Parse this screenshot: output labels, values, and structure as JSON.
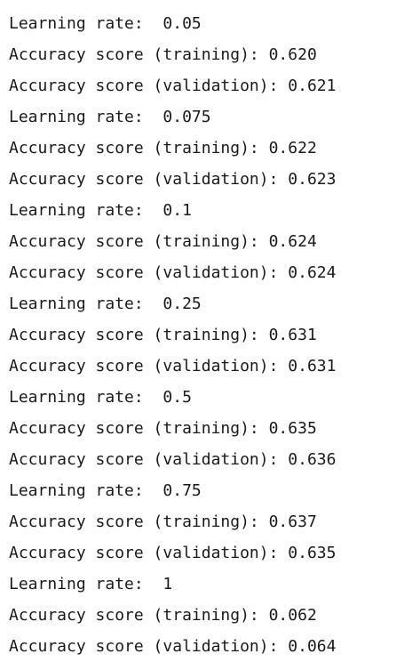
{
  "output": {
    "lines": [
      "Learning rate:  0.05",
      "Accuracy score (training): 0.620",
      "Accuracy score (validation): 0.621",
      "Learning rate:  0.075",
      "Accuracy score (training): 0.622",
      "Accuracy score (validation): 0.623",
      "Learning rate:  0.1",
      "Accuracy score (training): 0.624",
      "Accuracy score (validation): 0.624",
      "Learning rate:  0.25",
      "Accuracy score (training): 0.631",
      "Accuracy score (validation): 0.631",
      "Learning rate:  0.5",
      "Accuracy score (training): 0.635",
      "Accuracy score (validation): 0.636",
      "Learning rate:  0.75",
      "Accuracy score (training): 0.637",
      "Accuracy score (validation): 0.635",
      "Learning rate:  1",
      "Accuracy score (training): 0.062",
      "Accuracy score (validation): 0.064"
    ]
  }
}
